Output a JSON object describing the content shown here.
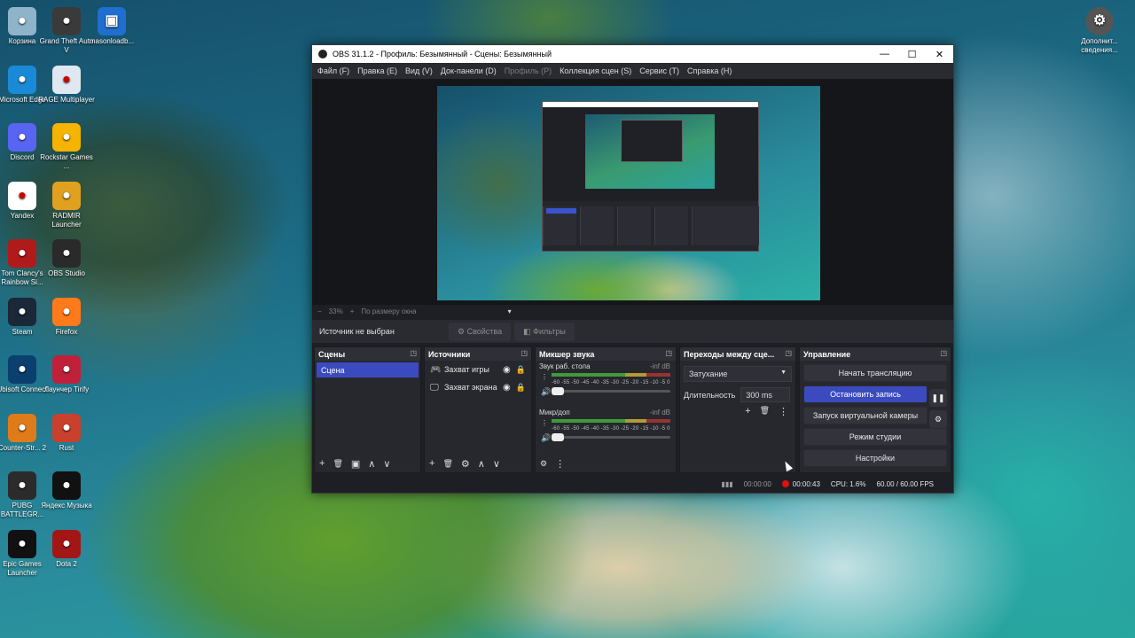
{
  "desktop": {
    "icons_left": [
      {
        "label": "Корзина",
        "icon": "recycle-bin-icon",
        "color": "#8fb3c9"
      },
      {
        "label": "Microsoft Edge",
        "icon": "edge-icon",
        "color": "#1a8ad6"
      },
      {
        "label": "Discord",
        "icon": "discord-icon",
        "color": "#5865f2"
      },
      {
        "label": "Yandex",
        "icon": "yandex-icon",
        "color": "#ffffff"
      },
      {
        "label": "Tom Clancy's Rainbow Si...",
        "icon": "rainbow-six-icon",
        "color": "#b11a1a"
      },
      {
        "label": "Steam",
        "icon": "steam-icon",
        "color": "#1b2838"
      },
      {
        "label": "Ubisoft Connect",
        "icon": "ubisoft-icon",
        "color": "#0a3f6e"
      },
      {
        "label": "Counter-Str... 2",
        "icon": "counter-strike-icon",
        "color": "#e07b1a"
      },
      {
        "label": "PUBG BATTLEGR...",
        "icon": "pubg-icon",
        "color": "#2b2b2b"
      },
      {
        "label": "Epic Games Launcher",
        "icon": "epic-games-icon",
        "color": "#111111"
      }
    ],
    "icons_col2": [
      {
        "label": "Grand Theft Auto V",
        "icon": "gta-icon",
        "color": "#3a3a3a"
      },
      {
        "label": "RAGE Multiplayer",
        "icon": "rage-icon",
        "color": "#dfe8f0"
      },
      {
        "label": "Rockstar Games ...",
        "icon": "rockstar-icon",
        "color": "#f4b400"
      },
      {
        "label": "RADMIR Launcher",
        "icon": "radmir-icon",
        "color": "#e0a020"
      },
      {
        "label": "OBS Studio",
        "icon": "obs-icon",
        "color": "#2a2a2a"
      },
      {
        "label": "Firefox",
        "icon": "firefox-icon",
        "color": "#ff7a1a"
      },
      {
        "label": "Лаунчер Tirify",
        "icon": "tirify-icon",
        "color": "#c0203a"
      },
      {
        "label": "Rust",
        "icon": "rust-icon",
        "color": "#c9402c"
      },
      {
        "label": "Яндекс Музыка",
        "icon": "yandex-music-icon",
        "color": "#111111"
      },
      {
        "label": "Dota 2",
        "icon": "dota-icon",
        "color": "#a31616"
      }
    ],
    "icon_col3": {
      "label": "masonloadb...",
      "icon": "window-icon",
      "color": "#1e6fd0"
    },
    "icon_right": {
      "label": "Дополнит... сведения...",
      "icon": "info-icon",
      "color": "#555555"
    }
  },
  "window": {
    "title": "OBS 31.1.2 - Профиль: Безымянный - Сцены: Безымянный",
    "controls": [
      "—",
      "☐",
      "✕"
    ],
    "menu": [
      {
        "label": "Файл (F)",
        "disabled": false
      },
      {
        "label": "Правка (E)",
        "disabled": false
      },
      {
        "label": "Вид (V)",
        "disabled": false
      },
      {
        "label": "Док-панели (D)",
        "disabled": false
      },
      {
        "label": "Профиль (P)",
        "disabled": true
      },
      {
        "label": "Коллекция сцен (S)",
        "disabled": false
      },
      {
        "label": "Сервис (T)",
        "disabled": false
      },
      {
        "label": "Справка (H)",
        "disabled": false
      }
    ]
  },
  "zoom": {
    "minus": "−",
    "value": "33%",
    "plus": "+",
    "mode": "По размеру окна",
    "arrow": "▾"
  },
  "source_bar": {
    "label": "Источник не выбран",
    "properties": "⚙ Свойства",
    "filters": "◧ Фильтры"
  },
  "docks": {
    "scenes": {
      "title": "Сцены",
      "items": [
        "Сцена"
      ],
      "tools": [
        "+",
        "🗑",
        "▣",
        "∧",
        "∨"
      ]
    },
    "sources": {
      "title": "Источники",
      "items": [
        {
          "label": "Захват игры",
          "icon": "gamepad-icon",
          "glyph": "🎮"
        },
        {
          "label": "Захват экрана",
          "icon": "monitor-icon",
          "glyph": "🖵"
        }
      ],
      "tools": [
        "+",
        "🗑",
        "⚙",
        "∧",
        "∨"
      ]
    },
    "mixer": {
      "title": "Микшер звука",
      "ticks": "-60 -55 -50 -45 -40 -35 -30 -25 -20 -15 -10 -5 0",
      "channels": [
        {
          "name": "Звук раб. стола",
          "db": "-inf dB"
        },
        {
          "name": "Микр/доп",
          "db": "-inf dB"
        }
      ],
      "tools": [
        "⚙",
        "⋮"
      ]
    },
    "transitions": {
      "title": "Переходы между сце...",
      "type": "Затухание",
      "duration_label": "Длительность",
      "duration": "300 ms",
      "tools": [
        "+",
        "🗑",
        "⋮"
      ]
    },
    "controls": {
      "title": "Управление",
      "buttons": [
        "Начать трансляцию",
        "Остановить запись",
        "Запуск виртуальной камеры",
        "Режим студии",
        "Настройки"
      ],
      "pause": "❚❚",
      "gear": "⚙"
    }
  },
  "status": {
    "stream_time": "00:00:00",
    "rec_time": "00:00:43",
    "cpu": "CPU: 1.6%",
    "fps": "60.00 / 60.00 FPS"
  },
  "colors": {
    "accent": "#3b4bbf",
    "rec": "#d11111"
  }
}
